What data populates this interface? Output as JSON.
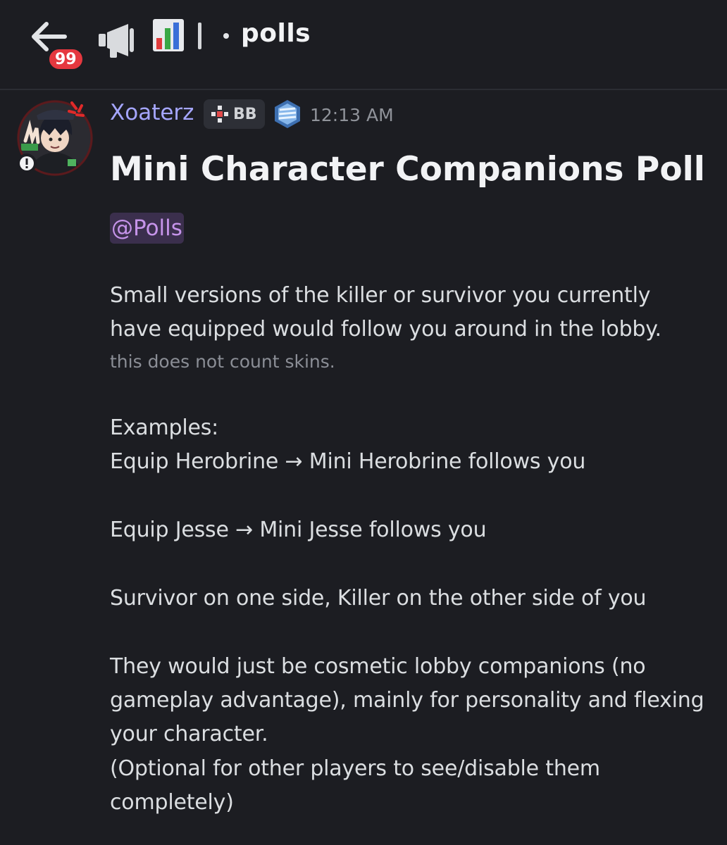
{
  "header": {
    "unread_badge": "99",
    "channel_emoji_megaphone": "megaphone-icon",
    "channel_emoji_chart": "bar-chart-icon",
    "channel_name": "polls"
  },
  "message": {
    "author": "Xoaterz",
    "guild_tag": "BB",
    "timestamp": "12:13 AM",
    "title": "Mini Character Companions Poll",
    "mention": "@Polls",
    "lines": [
      "Small versions of the killer or survivor you currently",
      "have equipped would follow you around in the lobby.",
      "Examples:",
      "Equip Herobrine → Mini Herobrine follows you",
      "Equip Jesse → Mini Jesse follows you",
      "Survivor on one side, Killer on the other side of you",
      "They would just be cosmetic lobby companions (no",
      "gameplay advantage), mainly for personality and flexing",
      "your character.",
      "(Optional for other players to see/disable them",
      "completely)"
    ],
    "subtext": "this does not count skins."
  },
  "colors": {
    "background": "#1c1d22",
    "username": "#a5a6ff",
    "mention_bg": "#3b2f4d",
    "mention_text": "#c694ea",
    "badge": "#e5383f"
  }
}
